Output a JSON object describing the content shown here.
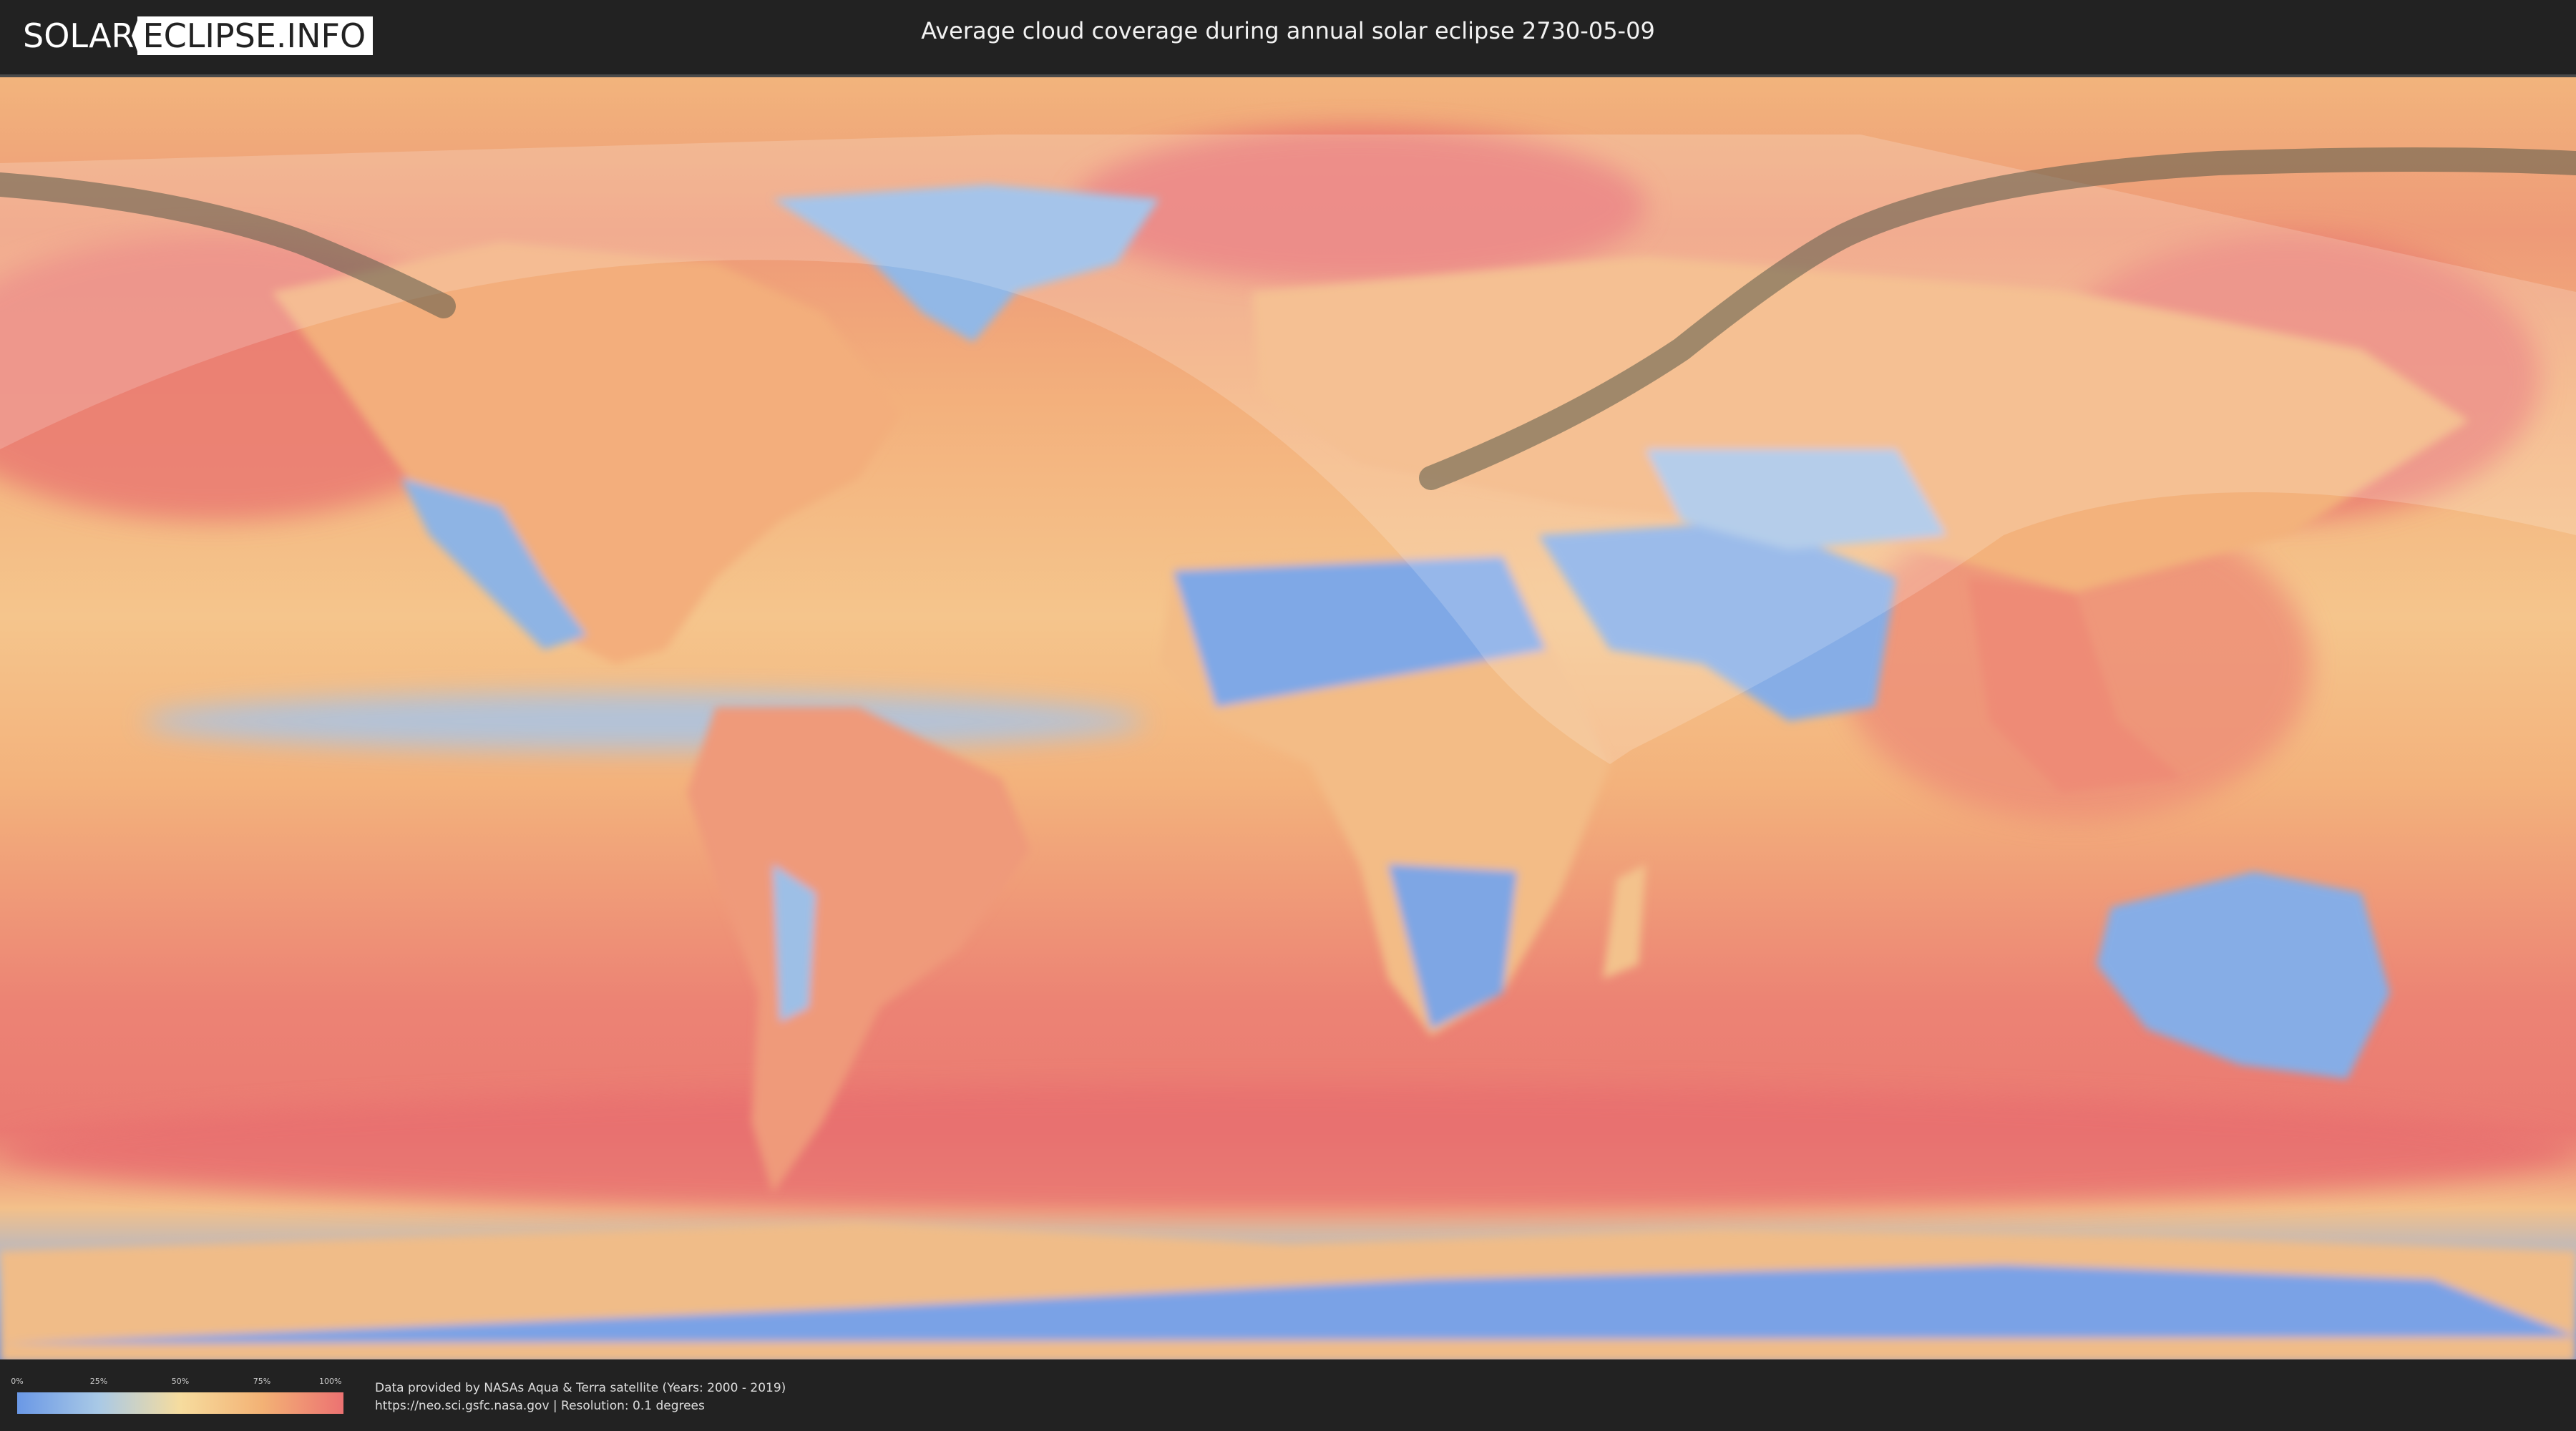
{
  "header": {
    "logo_left": "SOLAR",
    "logo_right": "ECLIPSE.INFO",
    "title": "Average cloud coverage during annual solar eclipse 2730-05-09"
  },
  "map": {
    "type": "cloud-coverage world map",
    "eclipse_path": "annular",
    "colors": {
      "low": "#6a98e6",
      "mid": "#f6dc9e",
      "high": "#ec7272",
      "path_band": "#5a5a48",
      "visibility_zone": "#ffffff"
    }
  },
  "legend": {
    "ticks": [
      "0%",
      "25%",
      "50%",
      "75%",
      "100%"
    ]
  },
  "attribution": {
    "line1": "Data provided by NASAs Aqua & Terra satellite (Years: 2000 - 2019)",
    "line2": "https://neo.sci.gsfc.nasa.gov | Resolution: 0.1 degrees"
  }
}
